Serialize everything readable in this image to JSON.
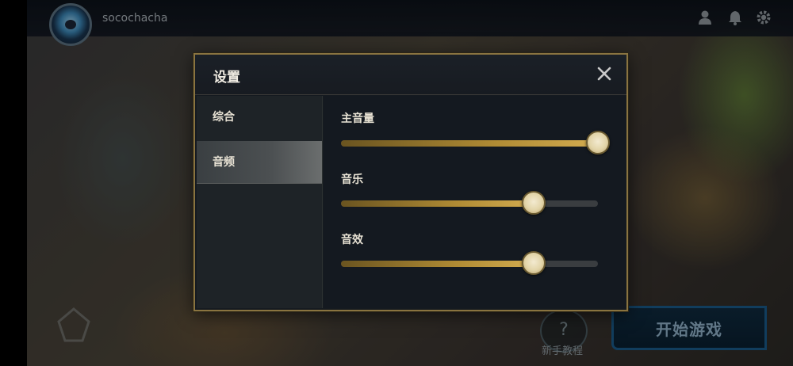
{
  "topbar": {
    "username": "socochacha",
    "icons": [
      "profile-icon",
      "bell-icon",
      "gear-icon"
    ]
  },
  "bottom": {
    "tutorial_icon": "?",
    "tutorial_label": "新手教程",
    "start_label": "开始游戏"
  },
  "dialog": {
    "title": "设置",
    "close_icon": "close-icon",
    "tabs": [
      {
        "label": "综合",
        "active": false
      },
      {
        "label": "音频",
        "active": true
      }
    ],
    "sliders": [
      {
        "label": "主音量",
        "value": 1.0
      },
      {
        "label": "音乐",
        "value": 0.75
      },
      {
        "label": "音效",
        "value": 0.75
      }
    ]
  },
  "colors": {
    "gold_border": "#8a7440",
    "fill_gold": "#d3ac50",
    "start_border": "#1a5a8a"
  }
}
